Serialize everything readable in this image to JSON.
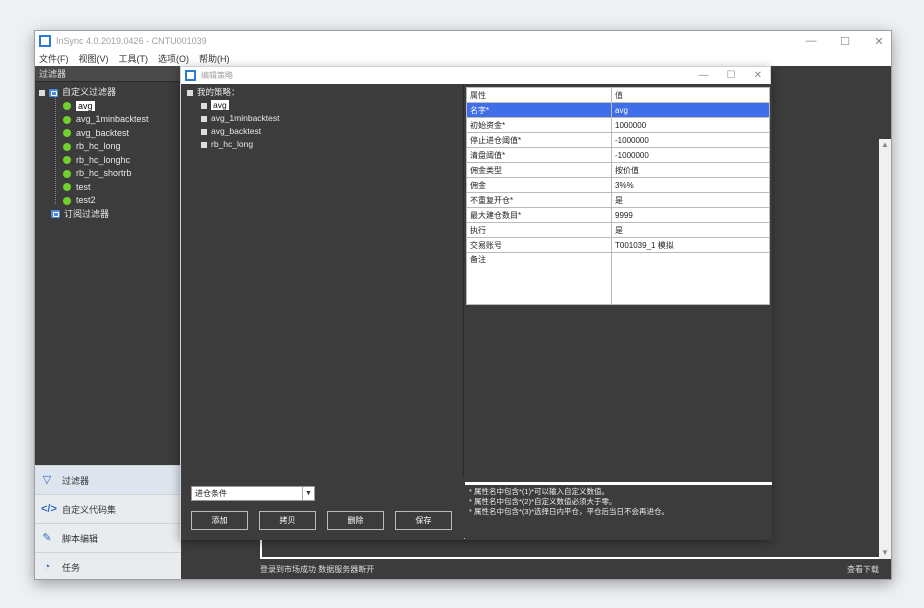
{
  "window": {
    "title": "InSync 4.0.2019.0426 - CNTU001039",
    "controls": [
      "—",
      "☐",
      "✕"
    ]
  },
  "menu": [
    "文件(F)",
    "视图(V)",
    "工具(T)",
    "选项(O)",
    "帮助(H)"
  ],
  "filter_panel": {
    "header": "过滤器",
    "root_label": "自定义过滤器",
    "items": [
      "avg",
      "avg_1minbacktest",
      "avg_backtest",
      "rb_hc_long",
      "rb_hc_longhc",
      "rb_hc_shortrb",
      "test",
      "test2"
    ],
    "sub_label": "订阅过滤器"
  },
  "nav": [
    {
      "label": "过滤器",
      "icon": "funnel-icon"
    },
    {
      "label": "自定义代码集",
      "icon": "code-icon"
    },
    {
      "label": "脚本编辑",
      "icon": "edit-icon"
    },
    {
      "label": "任务",
      "icon": "task-icon"
    }
  ],
  "status": {
    "left": "登录到市场成功  数据服务器断开",
    "right": "查看下载"
  },
  "dialog": {
    "title": "编辑策略",
    "controls": [
      "—",
      "☐",
      "✕"
    ],
    "tree_root": "我的策略：",
    "strategies": [
      "avg",
      "avg_1minbacktest",
      "avg_backtest",
      "rb_hc_long"
    ],
    "prop_header": {
      "key": "属性",
      "value": "值"
    },
    "props": [
      {
        "key": "名字*",
        "value": "avg"
      },
      {
        "key": "初始资金*",
        "value": "1000000"
      },
      {
        "key": "停止进仓阈值*",
        "value": "-1000000"
      },
      {
        "key": "清盘阈值*",
        "value": "-1000000"
      },
      {
        "key": "佣金类型",
        "value": "按价值"
      },
      {
        "key": "佣金",
        "value": "3%%"
      },
      {
        "key": "不重复开仓*",
        "value": "是"
      },
      {
        "key": "最大建仓数目*",
        "value": "9999"
      },
      {
        "key": "执行",
        "value": "是"
      },
      {
        "key": "交易账号",
        "value": "T001039_1 模拟"
      },
      {
        "key": "备注",
        "value": ""
      }
    ],
    "hints": [
      "* 属性名中包含*(1)*可以输入自定义数值。",
      "* 属性名中包含*(2)*自定义数值必须大于零。",
      "* 属性名中包含*(3)*选择日内平仓，平仓后当日不会再进仓。"
    ],
    "combo_value": "进仓条件",
    "buttons": {
      "add": "添加",
      "copy": "拷贝",
      "delete": "删除",
      "save": "保存"
    }
  }
}
